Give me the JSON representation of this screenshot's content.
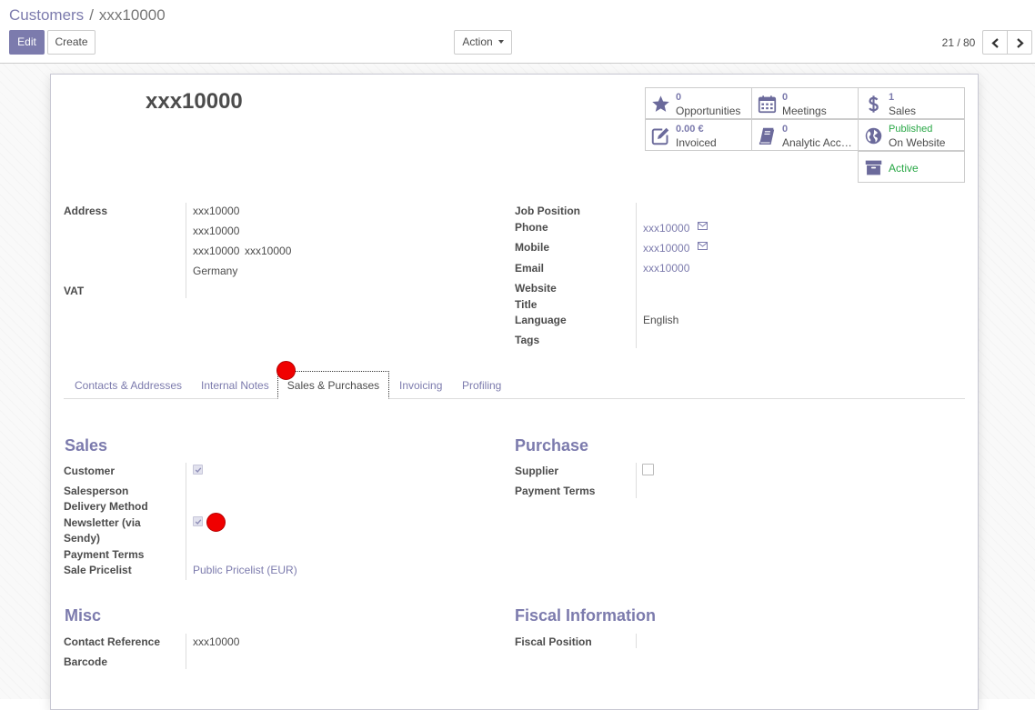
{
  "breadcrumb": {
    "parent": "Customers",
    "separator": "/",
    "current": "xxx10000"
  },
  "toolbar": {
    "edit_label": "Edit",
    "create_label": "Create",
    "action_label": "Action"
  },
  "pager": {
    "value": "21 / 80"
  },
  "record": {
    "name": "xxx10000"
  },
  "smart_buttons": {
    "opportunities": {
      "value": "0",
      "label": "Opportunities",
      "icon": "star-icon"
    },
    "meetings": {
      "value": "0",
      "label": "Meetings",
      "icon": "calendar-icon"
    },
    "sales": {
      "value": "1",
      "label": "Sales",
      "icon": "dollar-icon"
    },
    "invoiced": {
      "value": "0.00 €",
      "label": "Invoiced",
      "icon": "pencil-square-icon"
    },
    "analytic": {
      "value": "0",
      "label": "Analytic Acc…",
      "icon": "book-icon"
    },
    "website": {
      "value": "Published",
      "label": "On Website",
      "icon": "globe-icon"
    },
    "active": {
      "label": "Active",
      "icon": "archive-icon"
    }
  },
  "address": {
    "label": "Address",
    "street": "xxx10000",
    "street2": "xxx10000",
    "zip": "xxx10000",
    "city": "xxx10000",
    "country": "Germany"
  },
  "vat": {
    "label": "VAT"
  },
  "contact": {
    "job_position_label": "Job Position",
    "phone_label": "Phone",
    "phone": "xxx10000",
    "mobile_label": "Mobile",
    "mobile": "xxx10000",
    "email_label": "Email",
    "email": "xxx10000",
    "website_label": "Website",
    "title_label": "Title",
    "language_label": "Language",
    "language": "English",
    "tags_label": "Tags"
  },
  "tabs": [
    "Contacts & Addresses",
    "Internal Notes",
    "Sales & Purchases",
    "Invoicing",
    "Profiling"
  ],
  "sales": {
    "heading": "Sales",
    "customer_label": "Customer",
    "customer_checked": true,
    "salesperson_label": "Salesperson",
    "delivery_label": "Delivery Method",
    "newsletter_label_1": "Newsletter (via",
    "newsletter_label_2": "Sendy)",
    "newsletter_checked": true,
    "payment_terms_label": "Payment Terms",
    "pricelist_label": "Sale Pricelist",
    "pricelist": "Public Pricelist (EUR)"
  },
  "purchase": {
    "heading": "Purchase",
    "supplier_label": "Supplier",
    "supplier_checked": false,
    "payment_terms_label": "Payment Terms"
  },
  "misc": {
    "heading": "Misc",
    "reference_label": "Contact Reference",
    "reference": "xxx10000",
    "barcode_label": "Barcode"
  },
  "fiscal": {
    "heading": "Fiscal Information",
    "position_label": "Fiscal Position"
  },
  "colors": {
    "accent": "#7c7bad",
    "success": "#28a745",
    "text": "#4c4c4c",
    "marker": "#f00000"
  }
}
